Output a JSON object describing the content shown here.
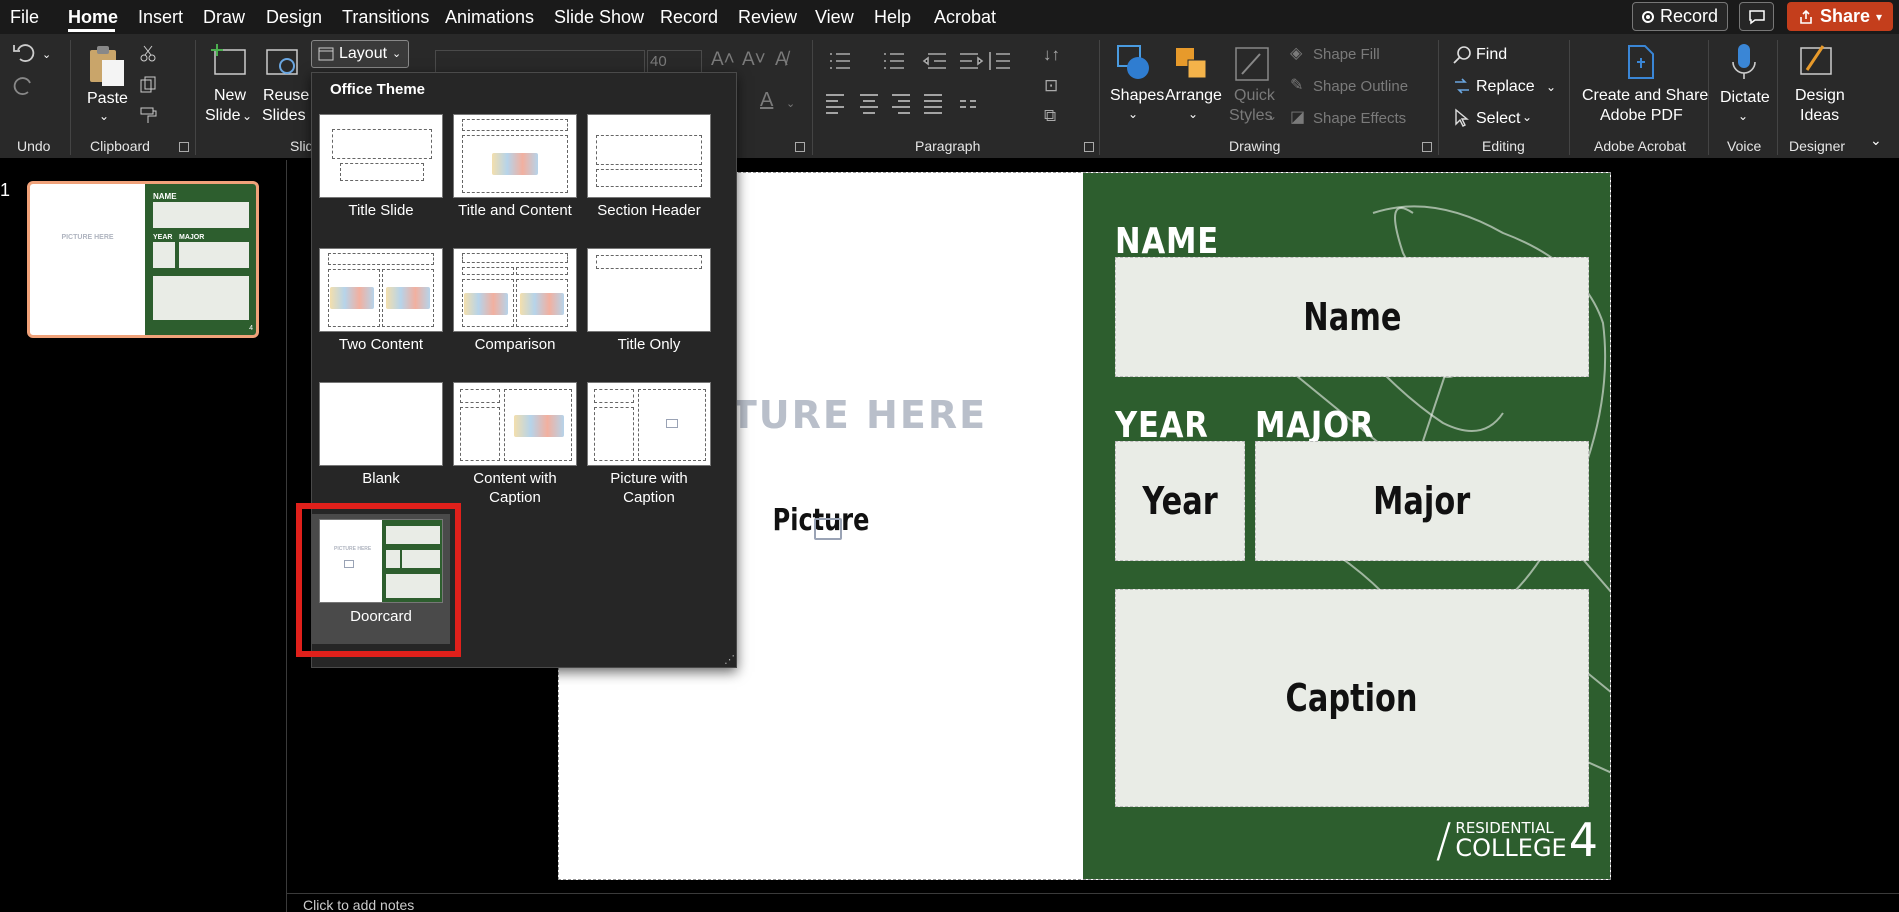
{
  "tabs": [
    {
      "label": "File",
      "active": false
    },
    {
      "label": "Home",
      "active": true
    },
    {
      "label": "Insert",
      "active": false
    },
    {
      "label": "Draw",
      "active": false
    },
    {
      "label": "Design",
      "active": false
    },
    {
      "label": "Transitions",
      "active": false
    },
    {
      "label": "Animations",
      "active": false
    },
    {
      "label": "Slide Show",
      "active": false
    },
    {
      "label": "Record",
      "active": false
    },
    {
      "label": "Review",
      "active": false
    },
    {
      "label": "View",
      "active": false
    },
    {
      "label": "Help",
      "active": false
    },
    {
      "label": "Acrobat",
      "active": false
    }
  ],
  "top_buttons": {
    "record": "Record",
    "share": "Share"
  },
  "ribbon": {
    "undo_group": "Undo",
    "clipboard": {
      "paste": "Paste",
      "group": "Clipboard"
    },
    "slides": {
      "new_slide_1": "New",
      "new_slide_2": "Slide",
      "reuse_1": "Reuse",
      "reuse_2": "Slides",
      "layout": "Layout",
      "group_partial": "Slid"
    },
    "font": {
      "size": "40"
    },
    "paragraph": {
      "group": "Paragraph"
    },
    "drawing": {
      "shapes": "Shapes",
      "arrange": "Arrange",
      "quick_styles_1": "Quick",
      "quick_styles_2": "Styles",
      "shape_fill": "Shape Fill",
      "shape_outline": "Shape Outline",
      "shape_effects": "Shape Effects",
      "group": "Drawing"
    },
    "editing": {
      "find": "Find",
      "replace": "Replace",
      "select": "Select",
      "group": "Editing"
    },
    "acrobat": {
      "line1": "Create and Share",
      "line2": "Adobe PDF",
      "group": "Adobe Acrobat"
    },
    "voice": {
      "dictate": "Dictate",
      "group": "Voice"
    },
    "designer": {
      "line1": "Design",
      "line2": "Ideas",
      "group": "Designer"
    }
  },
  "thumbnail": {
    "slide_number": "1",
    "picture_text": "PICTURE HERE",
    "name_text": "NAME",
    "year_text": "YEAR",
    "major_text": "MAJOR"
  },
  "layout_panel": {
    "heading": "Office Theme",
    "layouts": [
      {
        "name": "Title Slide"
      },
      {
        "name": "Title and Content"
      },
      {
        "name": "Section Header"
      },
      {
        "name": "Two Content"
      },
      {
        "name": "Comparison"
      },
      {
        "name": "Title Only"
      },
      {
        "name": "Blank"
      },
      {
        "name": "Content with Caption"
      },
      {
        "name": "Picture with Caption"
      },
      {
        "name": "Doorcard",
        "highlighted": true
      }
    ]
  },
  "slide": {
    "picture_placeholder": "PICTURE HERE",
    "picture_label": "Picture",
    "name_heading": "NAME",
    "name_box": "Name",
    "year_heading": "YEAR",
    "year_box": "Year",
    "major_heading": "MAJOR",
    "major_box": "Major",
    "caption_box": "Caption",
    "logo": {
      "slash": "/",
      "line1": "RESIDENTIAL",
      "line2": "COLLEGE",
      "number": "4"
    },
    "colors": {
      "green": "#2d5e2e",
      "card": "#e9ece6",
      "highlight": "#e0201b"
    }
  },
  "notes_placeholder": "Click to add notes"
}
